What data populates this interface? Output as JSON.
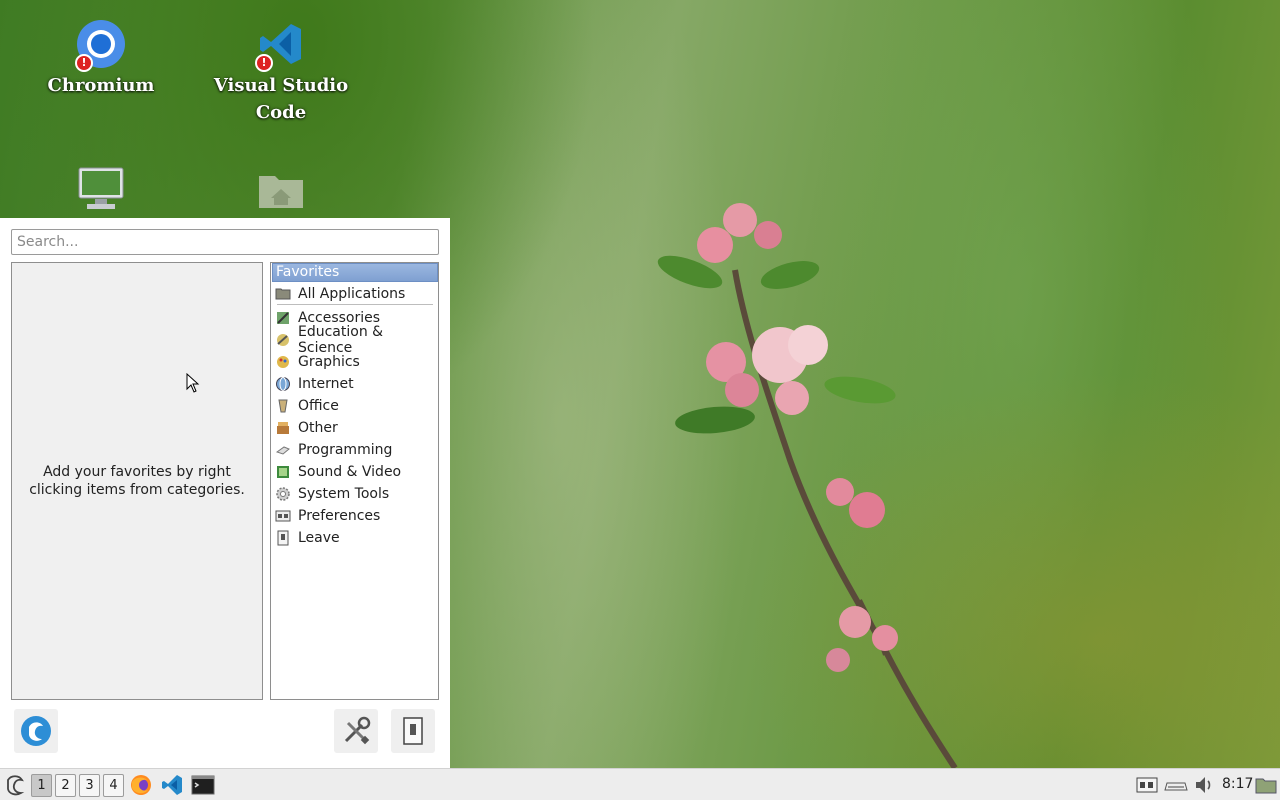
{
  "desktop": {
    "icons": [
      {
        "label": "Chromium",
        "icon": "chromium-icon"
      },
      {
        "label": "Visual Studio Code",
        "icon": "vscode-icon"
      },
      {
        "label": "",
        "icon": "computer-icon"
      },
      {
        "label": "",
        "icon": "home-folder-icon"
      }
    ]
  },
  "menu": {
    "search_placeholder": "Search...",
    "favorites_hint": "Add your favorites by right clicking items from categories.",
    "categories": [
      {
        "label": "Favorites",
        "icon": "favorites-icon",
        "selected": true
      },
      {
        "label": "All Applications",
        "icon": "folder-icon"
      },
      {
        "label": "Accessories",
        "icon": "accessories-icon"
      },
      {
        "label": "Education & Science",
        "icon": "education-icon"
      },
      {
        "label": "Graphics",
        "icon": "graphics-icon"
      },
      {
        "label": "Internet",
        "icon": "internet-icon"
      },
      {
        "label": "Office",
        "icon": "office-icon"
      },
      {
        "label": "Other",
        "icon": "other-icon"
      },
      {
        "label": "Programming",
        "icon": "programming-icon"
      },
      {
        "label": "Sound & Video",
        "icon": "sound-video-icon"
      },
      {
        "label": "System Tools",
        "icon": "system-tools-icon"
      },
      {
        "label": "Preferences",
        "icon": "preferences-icon"
      },
      {
        "label": "Leave",
        "icon": "leave-icon"
      }
    ],
    "bottom_buttons": [
      "about-icon",
      "settings-icon",
      "leave-icon"
    ]
  },
  "taskbar": {
    "workspaces": [
      "1",
      "2",
      "3",
      "4"
    ],
    "active_workspace": "1",
    "launchers": [
      "firefox-icon",
      "vscode-icon",
      "terminal-icon"
    ],
    "tray": [
      "keyboard-layout-icon",
      "network-icon",
      "volume-icon"
    ],
    "clock": "8:17"
  }
}
